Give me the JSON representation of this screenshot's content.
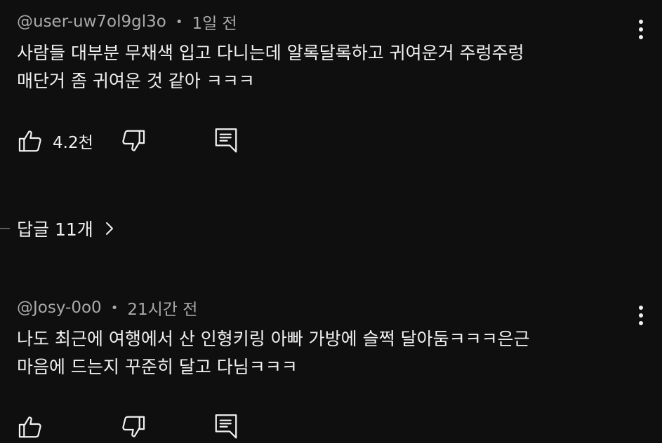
{
  "comments": [
    {
      "author": "@user-uw7ol9gl3o",
      "separator": "•",
      "time": "1일 전",
      "lines": [
        "사람들 대부분 무채색 입고 다니는데 알록달록하고 귀여운거 주렁주렁",
        "매단거 좀 귀여운 것 같아 ㅋㅋㅋ"
      ],
      "likes": "4.2천",
      "replies_label": "답글 11개"
    },
    {
      "author": "@Josy-0o0",
      "separator": "•",
      "time": "21시간 전",
      "lines": [
        "나도 최근에 여행에서 산 인형키링 아빠 가방에 슬쩍 달아둠ㅋㅋㅋ은근",
        "마음에 드는지 꾸준히 달고 다님ㅋㅋㅋ"
      ]
    }
  ],
  "icons": {
    "like": "thumb-up-icon",
    "dislike": "thumb-down-icon",
    "reply": "reply-icon",
    "menu": "more-vert-icon",
    "expand": "chevron-right-icon"
  }
}
